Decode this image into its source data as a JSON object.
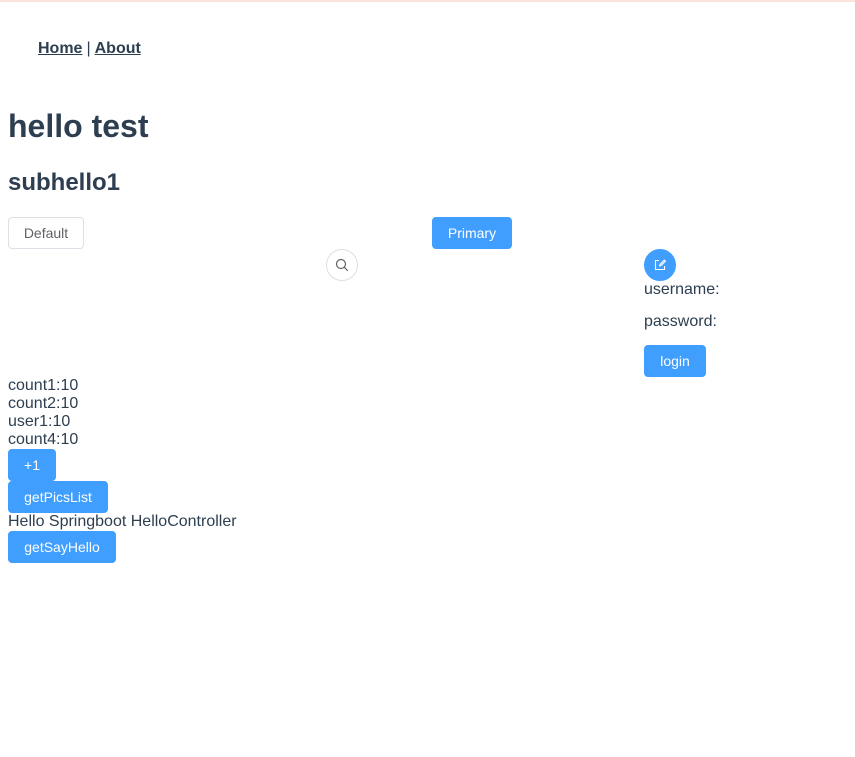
{
  "nav": {
    "home": "Home",
    "separator": "|",
    "about": "About"
  },
  "heading": "hello test",
  "subheading": "subhello1",
  "buttons": {
    "default": "Default",
    "primary": "Primary",
    "login": "login",
    "plus_one": "+1",
    "get_pics_list": "getPicsList",
    "get_say_hello": "getSayHello"
  },
  "icons": {
    "search": "search-icon",
    "edit": "edit-icon"
  },
  "login_form": {
    "username_label": "username:",
    "password_label": "password:"
  },
  "counters": [
    "count1:10",
    "count2:10",
    "user1:10",
    "count4:10"
  ],
  "message": "Hello Springboot HelloController",
  "colors": {
    "primary": "#409eff",
    "text": "#2c3e50",
    "border": "#dcdfe6"
  }
}
